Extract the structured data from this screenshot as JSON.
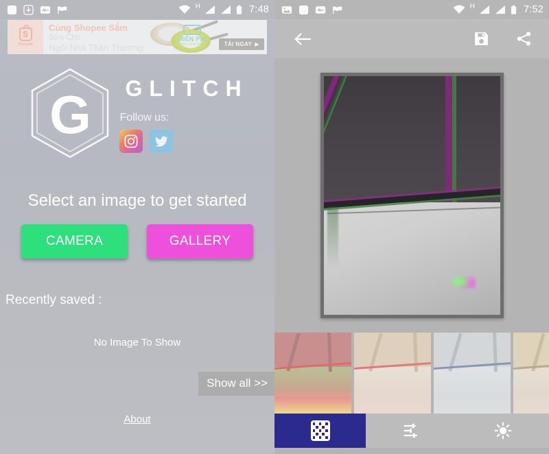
{
  "left_panel": {
    "statusbar": {
      "time": "7:48",
      "network_label": "H",
      "icons": [
        "blank-app-icon",
        "download-icon",
        "activity-icon",
        "check-flag-icon",
        "wifi-icon",
        "signal-icon",
        "signal-icon-2",
        "battery-icon"
      ]
    },
    "ad": {
      "brand": "Shopee",
      "brand_letter": "S",
      "line1": "Cùng Shopee Sắm",
      "line2": "Sửa Cho",
      "line3": "Ngôi Nhà Thân Thương",
      "badge_line1": "MIỄN PHÍ",
      "badge_line2": "VẬN CHUYỂN",
      "cta_label": "TẢI NGAY",
      "cta_arrow": "▶"
    },
    "brand": {
      "logo_letter": "G",
      "title": "GLITCH",
      "follow_label": "Follow us:",
      "social": [
        {
          "name": "instagram",
          "glyph": "instagram-icon"
        },
        {
          "name": "twitter",
          "glyph": "twitter-icon"
        }
      ]
    },
    "headline": "Select an image to get started",
    "buttons": {
      "camera": "CAMERA",
      "gallery": "GALLERY",
      "camera_color": "#2ee07c",
      "gallery_color": "#ee4fdb"
    },
    "recently_saved_label": "Recently saved :",
    "empty_state": "No Image To Show",
    "show_all": "Show all >>",
    "about": "About"
  },
  "right_panel": {
    "statusbar": {
      "time": "7:52",
      "network_label": "H",
      "icons": [
        "gallery-icon",
        "blank-app-icon",
        "activity-icon",
        "check-flag-icon",
        "wifi-icon",
        "signal-icon",
        "signal-icon-2",
        "battery-icon"
      ]
    },
    "toolbar": {
      "back": "←",
      "save_icon": "save-icon",
      "share_icon": "share-icon"
    },
    "preview": {
      "description": "Glitched photo of a ceiling with magenta and green chromatic-aberration beams"
    },
    "thumbnails": [
      {
        "name": "effect-thumbnail-1",
        "top_color": "#c98e8e",
        "bottom_color": "#b7c293",
        "accent": "#e06b6b"
      },
      {
        "name": "effect-thumbnail-2",
        "top_color": "#ded0bd",
        "bottom_color": "#e8ddd6",
        "accent": "#e07a7a"
      },
      {
        "name": "effect-thumbnail-3",
        "top_color": "#d3d7d9",
        "bottom_color": "#dbdedf",
        "accent": "#8a96b2"
      },
      {
        "name": "effect-thumbnail-4",
        "top_color": "#ded3bb",
        "bottom_color": "#e4dcd2",
        "accent": "#b9a98f"
      }
    ],
    "bottom_tabs": [
      {
        "name": "tab-glitch",
        "icon": "checkerboard-icon",
        "active": true,
        "active_color": "#2b2b8f"
      },
      {
        "name": "tab-adjust",
        "icon": "sliders-icon",
        "active": false
      },
      {
        "name": "tab-brightness",
        "icon": "sun-icon",
        "active": false
      }
    ]
  }
}
